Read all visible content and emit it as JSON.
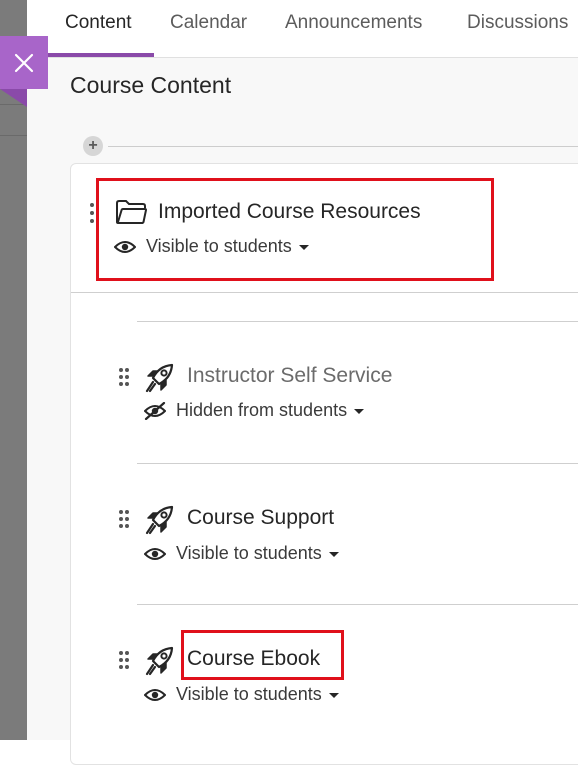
{
  "tabs": [
    {
      "label": "Content"
    },
    {
      "label": "Calendar"
    },
    {
      "label": "Announcements"
    },
    {
      "label": "Discussions"
    }
  ],
  "page_title": "Course Content",
  "items": [
    {
      "title": "Imported Course Resources",
      "icon": "folder-icon",
      "visibility": "Visible to students"
    },
    {
      "title": "Instructor Self Service",
      "icon": "rocket-icon",
      "visibility": "Hidden from students"
    },
    {
      "title": "Course Support",
      "icon": "rocket-icon",
      "visibility": "Visible to students"
    },
    {
      "title": "Course Ebook",
      "icon": "rocket-icon",
      "visibility": "Visible to students"
    }
  ],
  "colors": {
    "accent": "#8a4aa9",
    "close_bg": "#a865c9",
    "highlight": "#e0101b"
  }
}
